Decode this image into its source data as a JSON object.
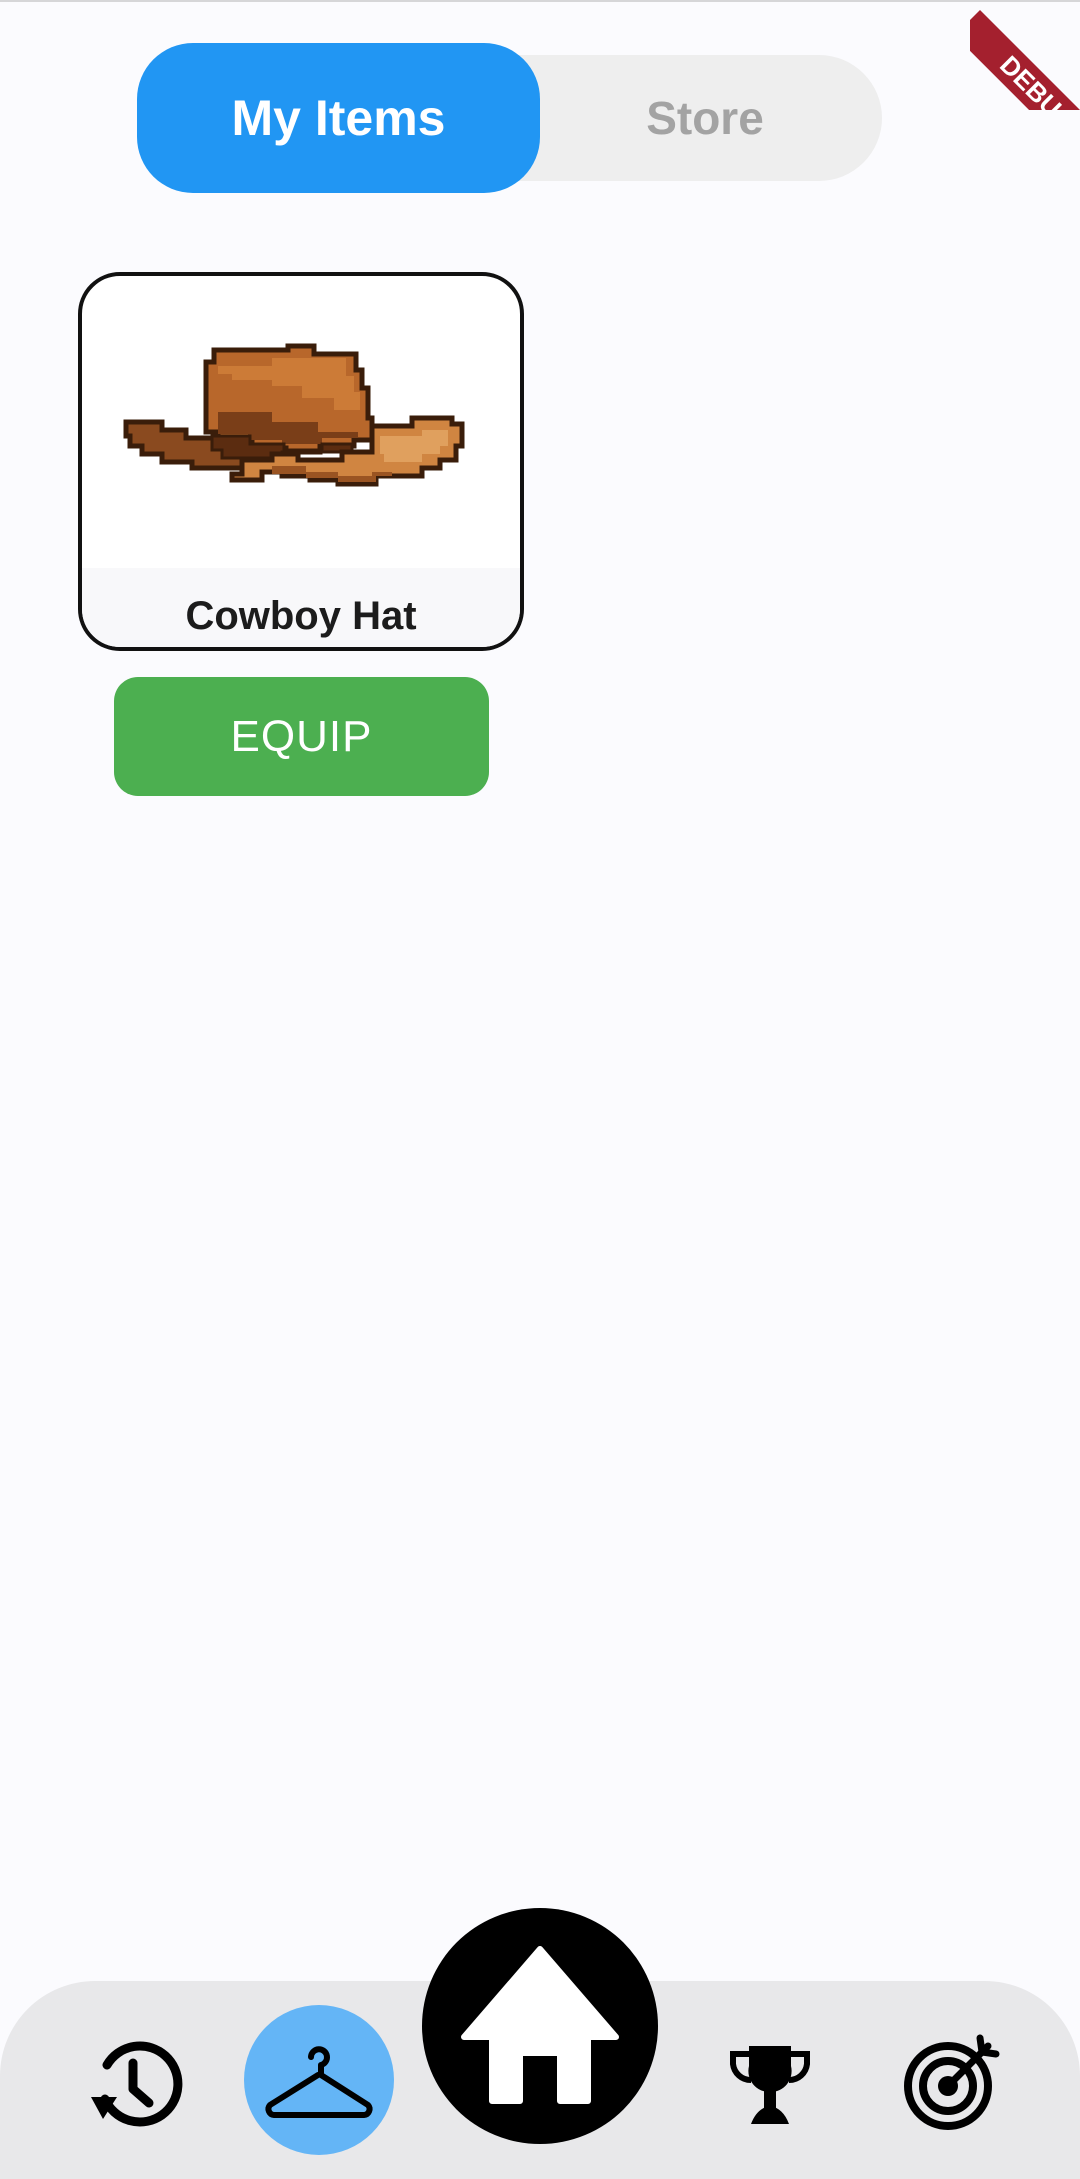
{
  "tabs": {
    "my_items_label": "My Items",
    "store_label": "Store",
    "active": "my_items",
    "active_color": "#2196f3"
  },
  "items": [
    {
      "name": "Cowboy Hat",
      "icon": "cowboy-hat-image",
      "action_label": "EQUIP",
      "action_color": "#4caf50"
    }
  ],
  "debug_banner": {
    "label": "DEBUG",
    "color": "#a4202e"
  },
  "bottom_nav": {
    "items": [
      {
        "icon": "history-icon"
      },
      {
        "icon": "hanger-icon",
        "active": true,
        "active_color": "#64b5f6"
      },
      {
        "icon": "home-icon"
      },
      {
        "icon": "trophy-icon"
      },
      {
        "icon": "target-icon"
      }
    ]
  }
}
